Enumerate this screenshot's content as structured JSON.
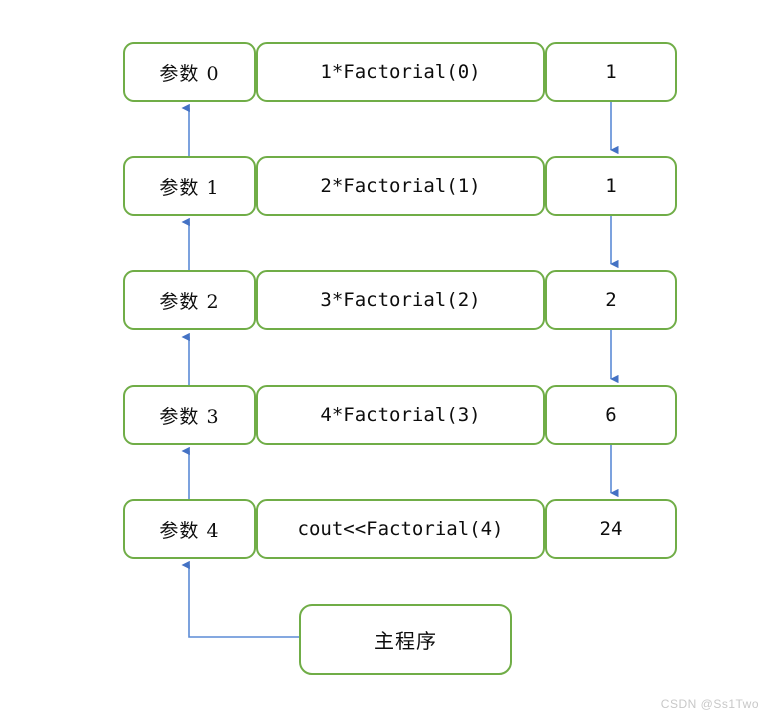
{
  "diagram": {
    "title": "Factorial recursion call stack diagram",
    "colors": {
      "box_border": "#70ad47",
      "box_fill": "#ffffff",
      "arrow": "#4472c4",
      "text": "#0d0d0d",
      "watermark": "#c8c8c8"
    },
    "rows": [
      {
        "param_label": "参数 0",
        "expression": "1*Factorial(0)",
        "result": "1"
      },
      {
        "param_label": "参数 1",
        "expression": "2*Factorial(1)",
        "result": "1"
      },
      {
        "param_label": "参数 2",
        "expression": "3*Factorial(2)",
        "result": "2"
      },
      {
        "param_label": "参数 3",
        "expression": "4*Factorial(3)",
        "result": "6"
      },
      {
        "param_label": "参数 4",
        "expression": "cout<<Factorial(4)",
        "result": "24"
      }
    ],
    "main_program": {
      "label": "主程序"
    },
    "connectors": {
      "left_arrow_direction": "up",
      "right_arrow_direction": "down",
      "entry_connector": "elbow-from-main-program-to-param-4"
    }
  },
  "watermark": {
    "text": "CSDN @Ss1Two"
  }
}
